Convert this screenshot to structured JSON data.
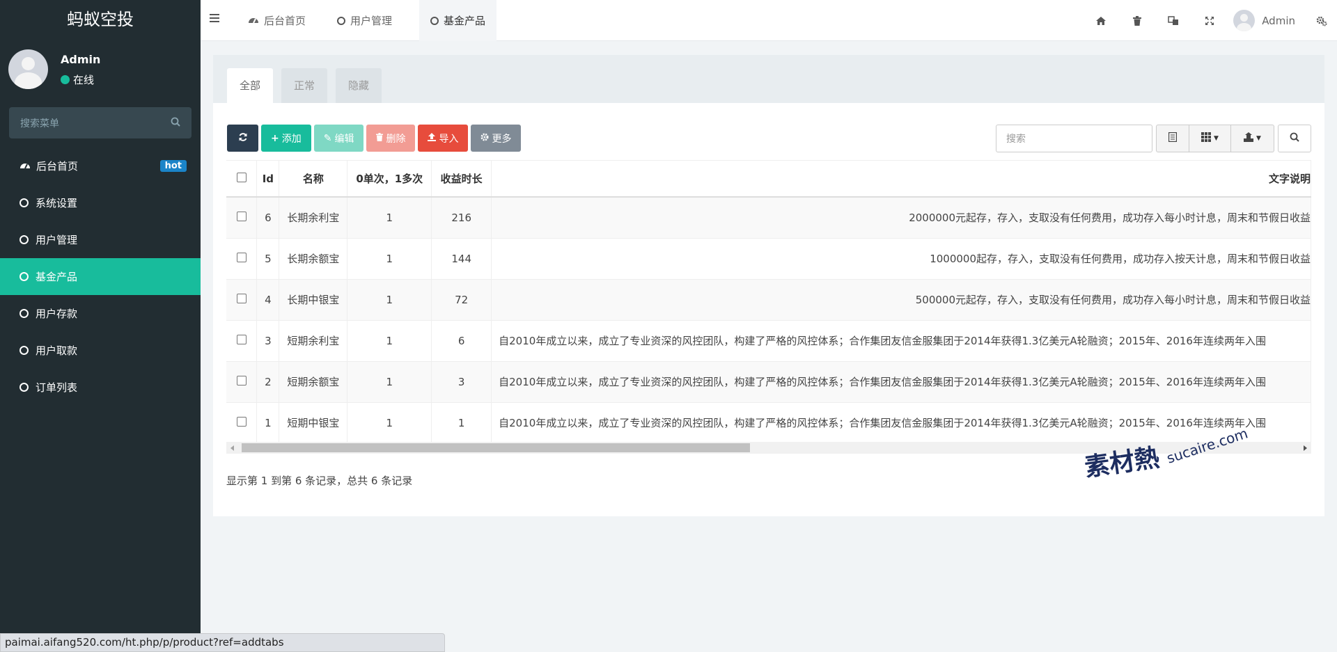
{
  "app": {
    "title": "蚂蚁空投"
  },
  "user": {
    "name": "Admin",
    "status": "在线"
  },
  "sidebar": {
    "search_placeholder": "搜索菜单",
    "items": [
      {
        "label": "后台首页",
        "icon": "dashboard-icon",
        "badge": "hot"
      },
      {
        "label": "系统设置",
        "icon": "circle-icon"
      },
      {
        "label": "用户管理",
        "icon": "circle-icon"
      },
      {
        "label": "基金产品",
        "icon": "circle-icon",
        "active": true
      },
      {
        "label": "用户存款",
        "icon": "circle-icon"
      },
      {
        "label": "用户取款",
        "icon": "circle-icon"
      },
      {
        "label": "订单列表",
        "icon": "circle-icon"
      }
    ]
  },
  "topnav": {
    "tabs": [
      {
        "label": "后台首页",
        "icon": "dashboard-icon"
      },
      {
        "label": "用户管理",
        "icon": "circle-icon"
      },
      {
        "label": "基金产品",
        "icon": "circle-icon",
        "active": true
      }
    ],
    "user_name": "Admin"
  },
  "panel": {
    "tabs": [
      "全部",
      "正常",
      "隐藏"
    ],
    "active_tab": "全部"
  },
  "toolbar": {
    "refresh_icon": "refresh-icon",
    "add_label": "添加",
    "edit_label": "编辑",
    "delete_label": "删除",
    "import_label": "导入",
    "more_label": "更多",
    "search_placeholder": "搜索"
  },
  "table": {
    "columns": [
      "Id",
      "名称",
      "0单次，1多次",
      "收益时长",
      "文字说明"
    ],
    "rows": [
      {
        "id": "6",
        "name": "长期余利宝",
        "mode": "1",
        "duration": "216",
        "desc": "2000000元起存，存入，支取没有任何费用，成功存入每小时计息，周末和节假日收益",
        "align": "right"
      },
      {
        "id": "5",
        "name": "长期余额宝",
        "mode": "1",
        "duration": "144",
        "desc": "1000000起存，存入，支取没有任何费用，成功存入按天计息，周末和节假日收益",
        "align": "right"
      },
      {
        "id": "4",
        "name": "长期中银宝",
        "mode": "1",
        "duration": "72",
        "desc": "500000元起存，存入，支取没有任何费用，成功存入每小时计息，周末和节假日收益",
        "align": "right"
      },
      {
        "id": "3",
        "name": "短期余利宝",
        "mode": "1",
        "duration": "6",
        "desc": "自2010年成立以来，成立了专业资深的风控团队，构建了严格的风控体系；合作集团友信金服集团于2014年获得1.3亿美元A轮融资；2015年、2016年连续两年入围",
        "align": "left"
      },
      {
        "id": "2",
        "name": "短期余额宝",
        "mode": "1",
        "duration": "3",
        "desc": "自2010年成立以来，成立了专业资深的风控团队，构建了严格的风控体系；合作集团友信金服集团于2014年获得1.3亿美元A轮融资；2015年、2016年连续两年入围",
        "align": "left"
      },
      {
        "id": "1",
        "name": "短期中银宝",
        "mode": "1",
        "duration": "1",
        "desc": "自2010年成立以来，成立了专业资深的风控团队，构建了严格的风控体系；合作集团友信金服集团于2014年获得1.3亿美元A轮融资；2015年、2016年连续两年入围",
        "align": "left"
      }
    ]
  },
  "pager_info": "显示第 1 到第 6 条记录，总共 6 条记录",
  "watermark": {
    "main": "素材熱",
    "sub": "sucaire.com"
  },
  "statusbar": "paimai.aifang520.com/ht.php/p/product?ref=addtabs",
  "colors": {
    "sidebar_bg": "#222d32",
    "accent": "#18bc9c",
    "danger": "#e74c3c",
    "dark": "#2c3e50"
  }
}
